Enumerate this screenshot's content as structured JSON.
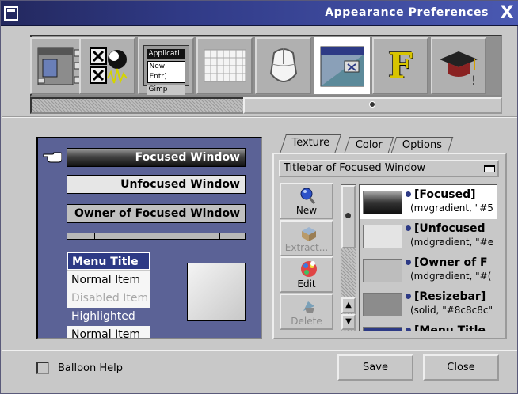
{
  "window": {
    "title": "Appearance Preferences",
    "close_glyph": "X"
  },
  "toolbar": {
    "items": [
      {
        "name": "window-settings-icon",
        "selected": false
      },
      {
        "name": "workspace-settings-icon",
        "selected": false
      },
      {
        "name": "menu-settings-icon",
        "selected": false,
        "lines": [
          "Applicati",
          "New Entr]",
          "Gimp"
        ]
      },
      {
        "name": "keyboard-icon",
        "selected": false
      },
      {
        "name": "mouse-icon",
        "selected": false
      },
      {
        "name": "appearance-icon",
        "selected": true
      },
      {
        "name": "font-icon",
        "selected": false,
        "glyph": "F"
      },
      {
        "name": "expert-icon",
        "selected": false
      }
    ]
  },
  "preview": {
    "focused_title": "Focused Window",
    "unfocused_title": "Unfocused Window",
    "owner_title": "Owner of Focused Window",
    "menu": {
      "title": "Menu Title",
      "normal": "Normal Item",
      "disabled": "Disabled Item",
      "highlighted": "Highlighted",
      "normal2": "Normal Item"
    }
  },
  "tabs": {
    "texture": "Texture",
    "color": "Color",
    "options": "Options"
  },
  "texture_panel": {
    "selected_target": "Titlebar of Focused Window",
    "buttons": {
      "new": "New",
      "extract": "Extract...",
      "edit": "Edit",
      "delete": "Delete"
    },
    "items": [
      {
        "name": "[Focused]",
        "desc": "(mvgradient, \"#5"
      },
      {
        "name": "[Unfocused",
        "desc": "(mdgradient, \"#e"
      },
      {
        "name": "[Owner of F",
        "desc": "(mdgradient, \"#("
      },
      {
        "name": "[Resizebar]",
        "desc": "(solid, \"#8c8c8c\""
      },
      {
        "name": "[Menu Title",
        "desc": ""
      }
    ]
  },
  "footer": {
    "balloon_help": "Balloon Help",
    "save": "Save",
    "close": "Close"
  },
  "colors": {
    "title_bar": "#2d3a85",
    "preview_bg": "#5b6296",
    "highlight": "#5b6296"
  }
}
